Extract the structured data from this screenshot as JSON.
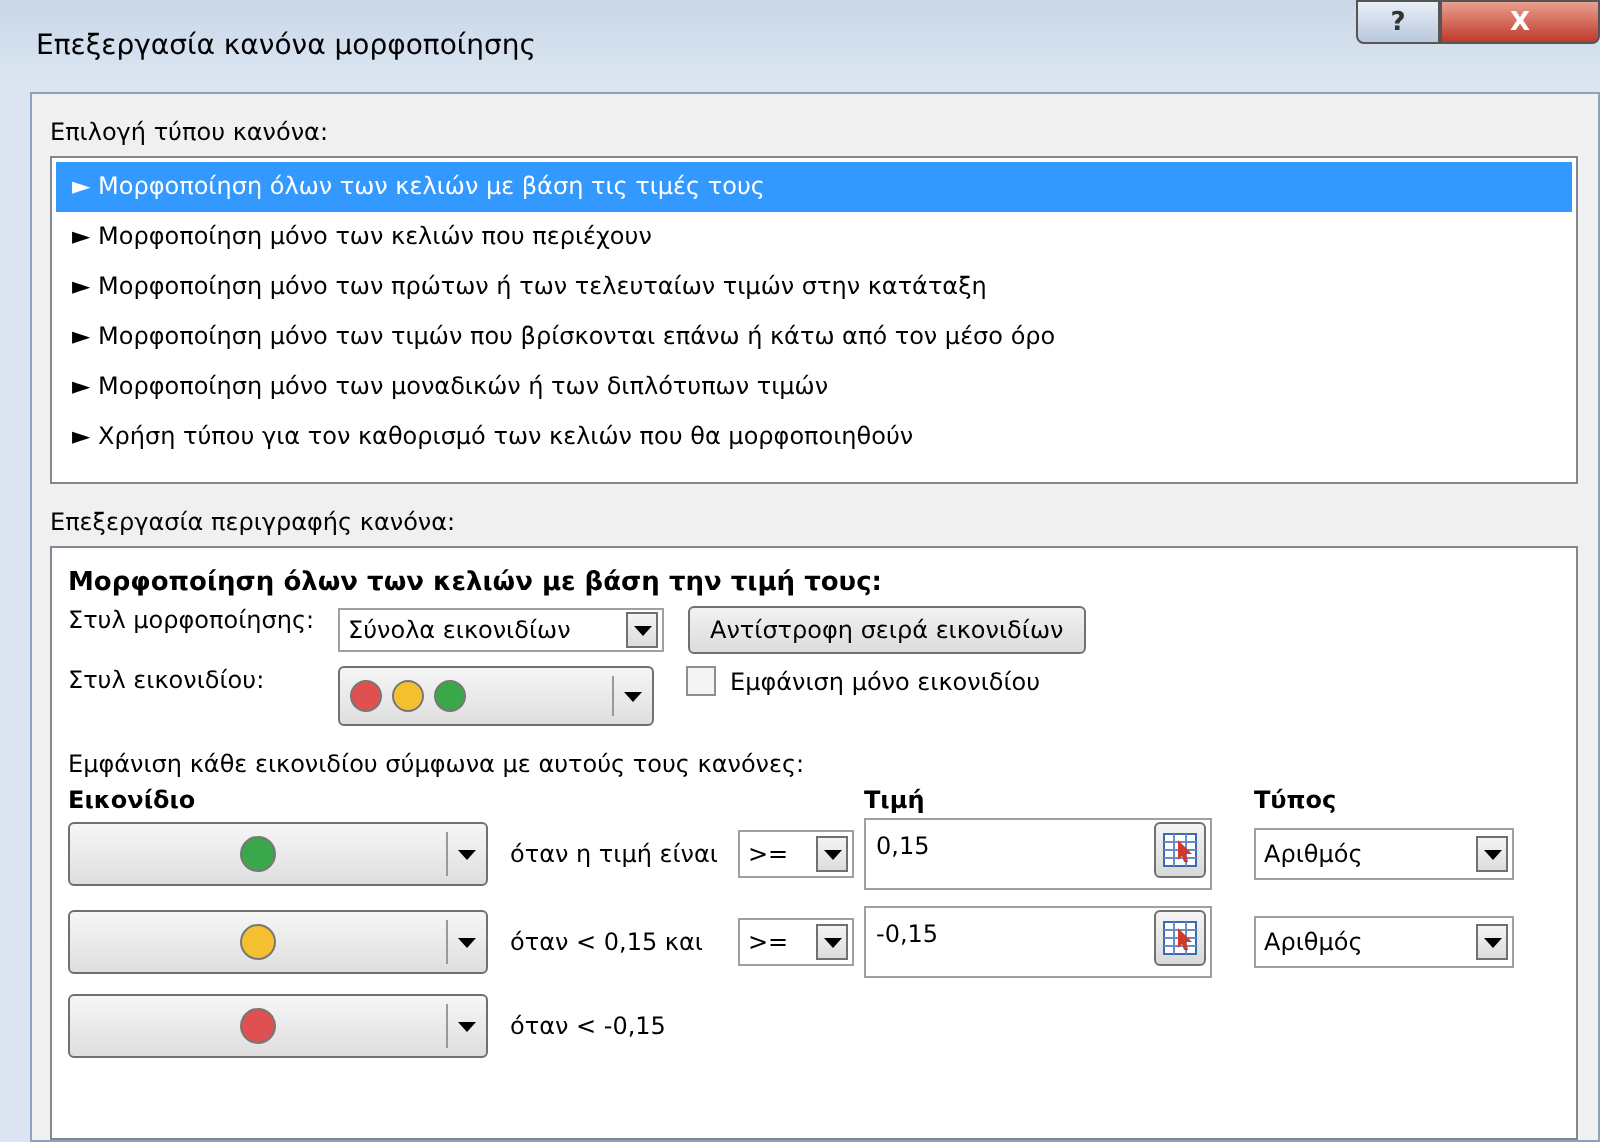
{
  "window": {
    "title": "Επεξεργασία κανόνα μορφοποίησης",
    "help_button": "?",
    "close_button": "X"
  },
  "rule_type": {
    "label": "Επιλογή τύπου κανόνα:",
    "items": [
      {
        "text": "► Μορφοποίηση όλων των κελιών με βάση τις τιμές τους",
        "selected": true
      },
      {
        "text": "► Μορφοποίηση μόνο των κελιών που περιέχουν",
        "selected": false
      },
      {
        "text": "► Μορφοποίηση μόνο των πρώτων ή των τελευταίων τιμών στην κατάταξη",
        "selected": false
      },
      {
        "text": "► Μορφοποίηση μόνο των τιμών που βρίσκονται επάνω ή κάτω από τον μέσο όρο",
        "selected": false
      },
      {
        "text": "► Μορφοποίηση μόνο των μοναδικών ή των διπλότυπων τιμών",
        "selected": false
      },
      {
        "text": "► Χρήση τύπου για τον καθορισμό των κελιών που θα μορφοποιηθούν",
        "selected": false
      }
    ]
  },
  "description": {
    "label": "Επεξεργασία περιγραφής κανόνα:",
    "heading": "Μορφοποίηση όλων των κελιών με βάση την τιμή τους:",
    "format_style": {
      "label": "Στυλ μορφοποίησης:",
      "value": "Σύνολα εικονιδίων"
    },
    "reverse_button": "Αντίστροφη σειρά εικονιδίων",
    "icon_style": {
      "label": "Στυλ εικονιδίου:",
      "icons": [
        {
          "color": "#e05050"
        },
        {
          "color": "#f5c030"
        },
        {
          "color": "#3aa84a"
        }
      ]
    },
    "show_icon_only": {
      "label": "Εμφάνιση μόνο εικονιδίου",
      "checked": false
    },
    "rules_intro": "Εμφάνιση κάθε εικονιδίου σύμφωνα με αυτούς τους κανόνες:",
    "columns": {
      "icon": "Εικονίδιο",
      "value": "Τιμή",
      "type": "Τύπος"
    },
    "rules": [
      {
        "color": "#3aa84a",
        "condition": "όταν η τιμή είναι",
        "operator": ">=",
        "value": "0,15",
        "type": "Αριθμός"
      },
      {
        "color": "#f5c030",
        "condition": "όταν < 0,15 και",
        "operator": ">=",
        "value": "-0,15",
        "type": "Αριθμός"
      },
      {
        "color": "#e05050",
        "condition": "όταν < -0,15"
      }
    ]
  }
}
